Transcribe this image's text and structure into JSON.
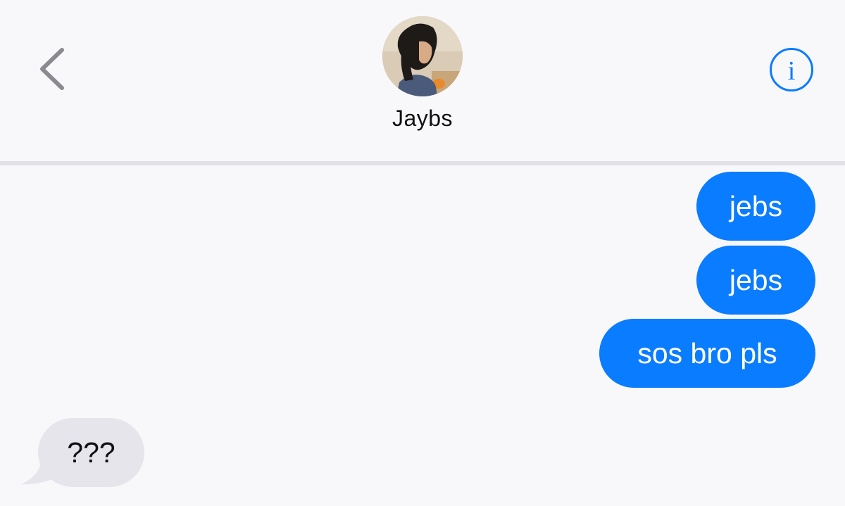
{
  "header": {
    "back_icon": "chevron-left-icon",
    "contact_name": "Jaybs",
    "info_icon": "info-icon",
    "accent_color": "#0a7cff"
  },
  "conversation": {
    "messages": [
      {
        "direction": "outgoing",
        "text": "jebs"
      },
      {
        "direction": "outgoing",
        "text": "jebs"
      },
      {
        "direction": "outgoing",
        "text": "sos bro pls"
      },
      {
        "direction": "incoming",
        "text": "???"
      }
    ]
  },
  "colors": {
    "outgoing_bubble": "#0a7cff",
    "incoming_bubble": "#e6e5eb",
    "background": "#f8f8fa"
  }
}
